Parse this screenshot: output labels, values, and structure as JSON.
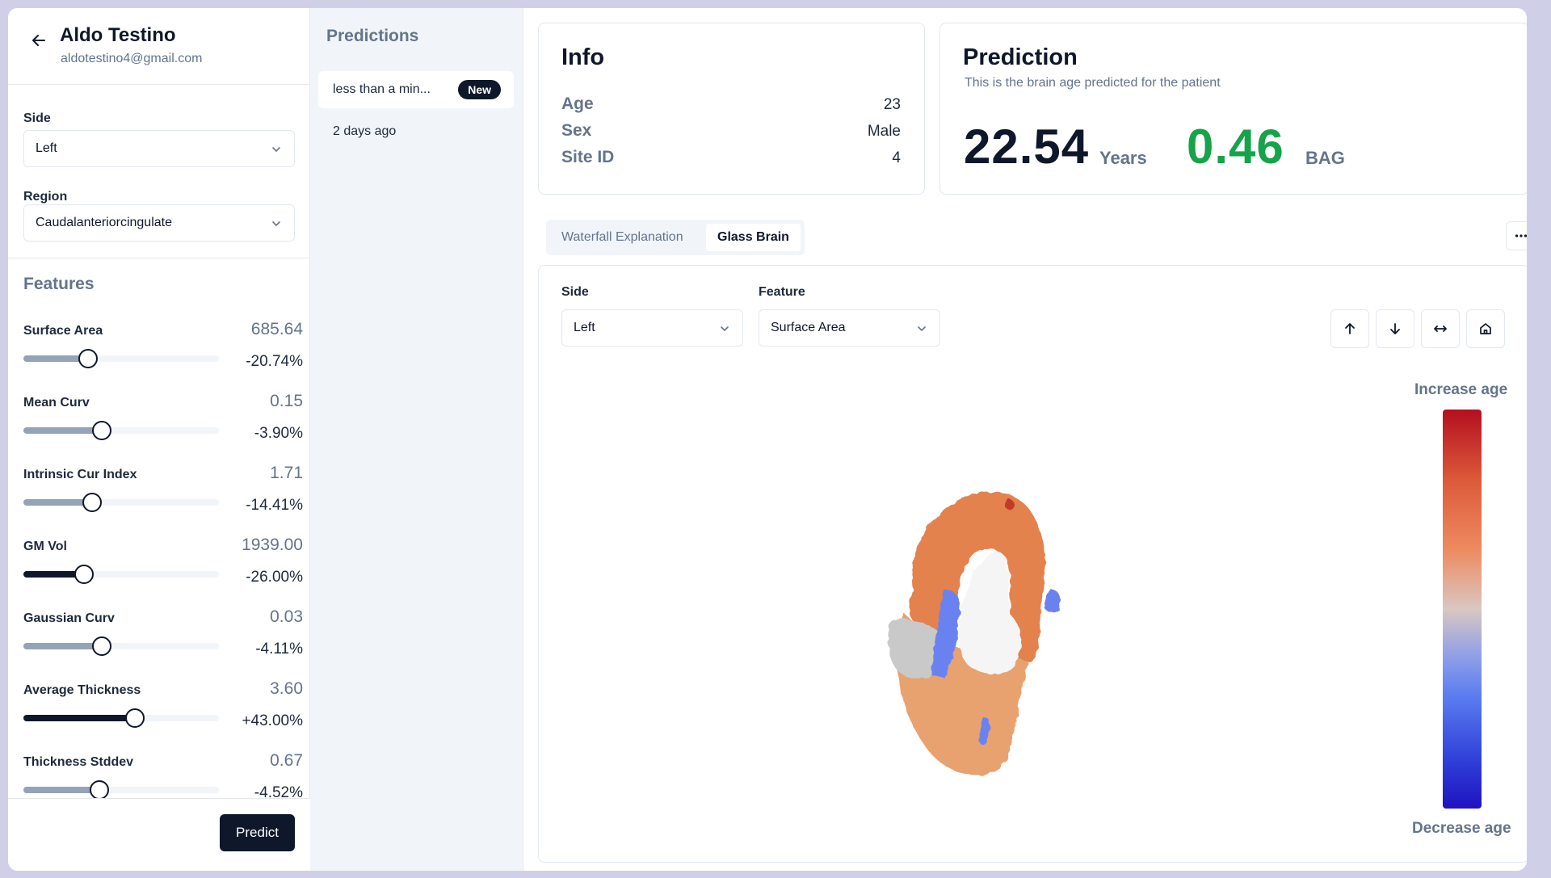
{
  "patient": {
    "name": "Aldo Testino",
    "email": "aldotestino4@gmail.com"
  },
  "left_panel": {
    "side_label": "Side",
    "side_value": "Left",
    "region_label": "Region",
    "region_value": "Caudalanteriorcingulate",
    "features_title": "Features",
    "features": [
      {
        "name": "Surface Area",
        "value": "685.64",
        "pct": "-20.74%",
        "fraction": 0.33,
        "dark": false
      },
      {
        "name": "Mean Curv",
        "value": "0.15",
        "pct": "-3.90%",
        "fraction": 0.4,
        "dark": false
      },
      {
        "name": "Intrinsic Cur Index",
        "value": "1.71",
        "pct": "-14.41%",
        "fraction": 0.35,
        "dark": false
      },
      {
        "name": "GM Vol",
        "value": "1939.00",
        "pct": "-26.00%",
        "fraction": 0.31,
        "dark": true
      },
      {
        "name": "Gaussian Curv",
        "value": "0.03",
        "pct": "-4.11%",
        "fraction": 0.4,
        "dark": false
      },
      {
        "name": "Average Thickness",
        "value": "3.60",
        "pct": "+43.00%",
        "fraction": 0.57,
        "dark": true
      },
      {
        "name": "Thickness Stddev",
        "value": "0.67",
        "pct": "-4.52%",
        "fraction": 0.39,
        "dark": false
      }
    ],
    "predict_label": "Predict"
  },
  "predictions": {
    "title": "Predictions",
    "items": [
      {
        "label": "less than a min...",
        "badge": "New"
      },
      {
        "label": "2 days ago",
        "badge": ""
      }
    ]
  },
  "info": {
    "title": "Info",
    "rows": [
      {
        "key": "Age",
        "value": "23"
      },
      {
        "key": "Sex",
        "value": "Male"
      },
      {
        "key": "Site ID",
        "value": "4"
      }
    ]
  },
  "prediction": {
    "title": "Prediction",
    "subtitle": "This is the brain age predicted for the patient",
    "age": "22.54",
    "age_unit": "Years",
    "bag": "0.46",
    "bag_unit": "BAG",
    "bag_color": "#16a34a"
  },
  "tabs": [
    {
      "label": "Waterfall Explanation",
      "active": false
    },
    {
      "label": "Glass Brain",
      "active": true
    }
  ],
  "glass_brain": {
    "side_label": "Side",
    "side_value": "Left",
    "feature_label": "Feature",
    "feature_value": "Surface Area",
    "scale_top": "Increase age",
    "scale_bottom": "Decrease age",
    "controls": [
      "arrow-up-icon",
      "arrow-down-icon",
      "arrows-horizontal-icon",
      "home-icon"
    ]
  },
  "colors": {
    "primary": "#0f172a",
    "muted": "#64748b",
    "accent_green": "#16a34a"
  }
}
